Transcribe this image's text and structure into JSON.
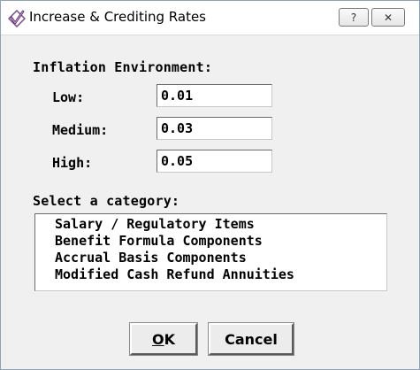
{
  "window": {
    "title": "Increase & Crediting Rates",
    "help_glyph": "?",
    "close_glyph": "✕"
  },
  "inflation": {
    "heading": "Inflation Environment:",
    "fields": [
      {
        "label": "Low:",
        "value": "0.01"
      },
      {
        "label": "Medium:",
        "value": "0.03"
      },
      {
        "label": "High:",
        "value": "0.05"
      }
    ]
  },
  "category": {
    "heading": "Select a category:",
    "items": [
      "Salary / Regulatory Items",
      "Benefit Formula Components",
      "Accrual Basis Components",
      "Modified Cash Refund Annuities"
    ]
  },
  "buttons": {
    "ok_first": "O",
    "ok_rest": "K",
    "cancel": "Cancel"
  },
  "icons": {
    "app": "checkmark-diamond-icon",
    "help": "help-icon",
    "close": "close-icon"
  }
}
